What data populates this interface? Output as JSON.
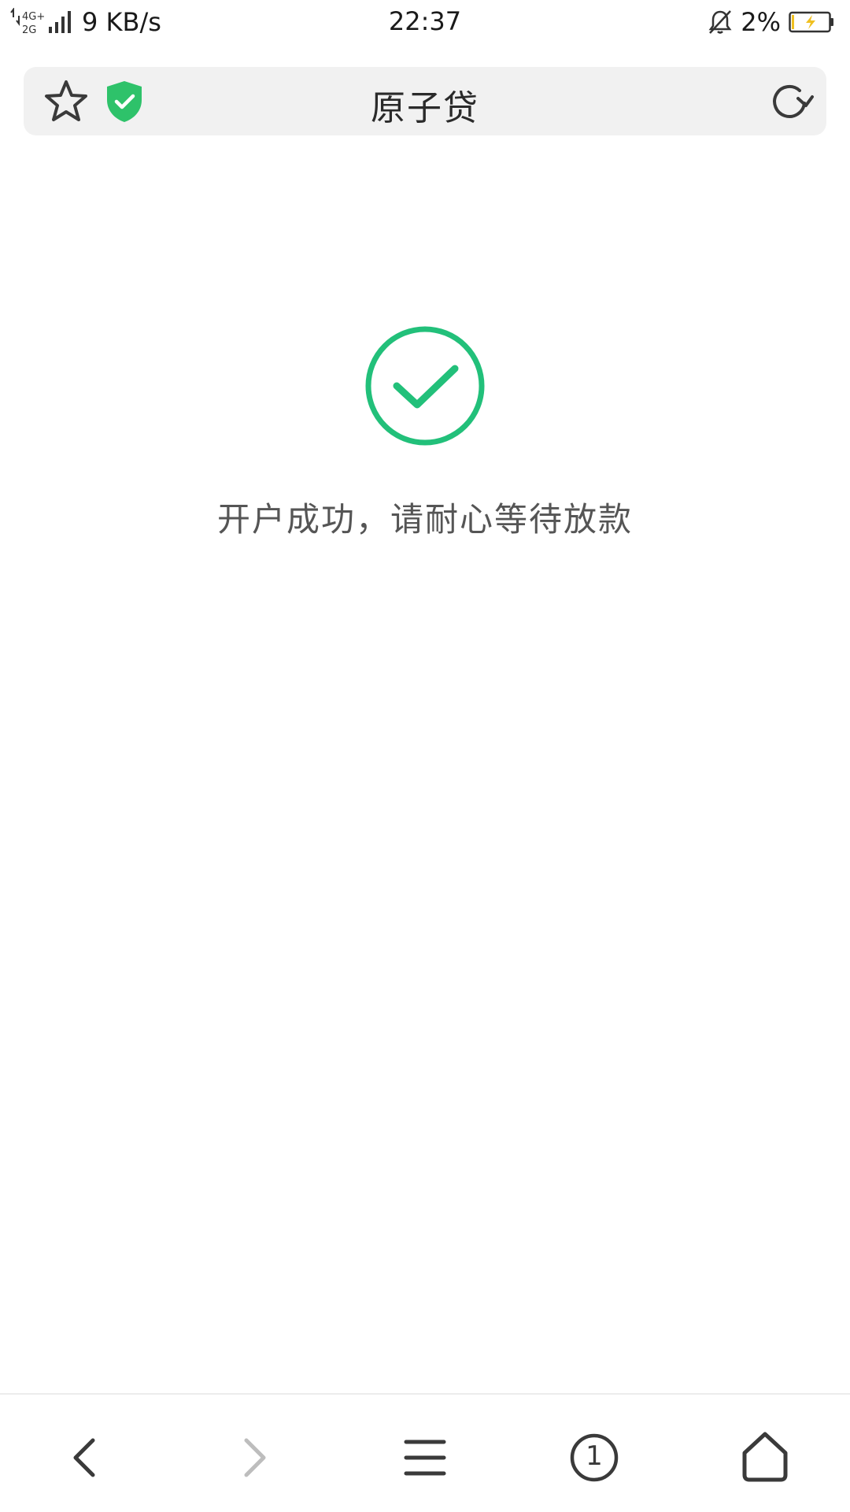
{
  "status_bar": {
    "network_type": "4G+\n2G",
    "net_speed": "9 KB/s",
    "time": "22:37",
    "battery_percent": "2%",
    "icons": [
      "data-arrows-icon",
      "signal-icon",
      "mute-bell-icon",
      "battery-charging-icon"
    ]
  },
  "address_bar": {
    "title": "原子贷",
    "icons": [
      "star-icon",
      "shield-check-icon",
      "reload-icon"
    ]
  },
  "content": {
    "message": "开户成功，请耐心等待放款",
    "success_color": "#22c07a"
  },
  "bottom_nav": {
    "tab_count": "1",
    "icons": [
      "back-icon",
      "forward-icon",
      "menu-icon",
      "tabs-icon",
      "home-icon"
    ]
  },
  "colors": {
    "accent_green": "#22c07a",
    "shield_green": "#2ec26a",
    "address_bar_bg": "#f1f1f1",
    "icon_dark": "#333333",
    "icon_disabled": "#bdbdbd"
  }
}
